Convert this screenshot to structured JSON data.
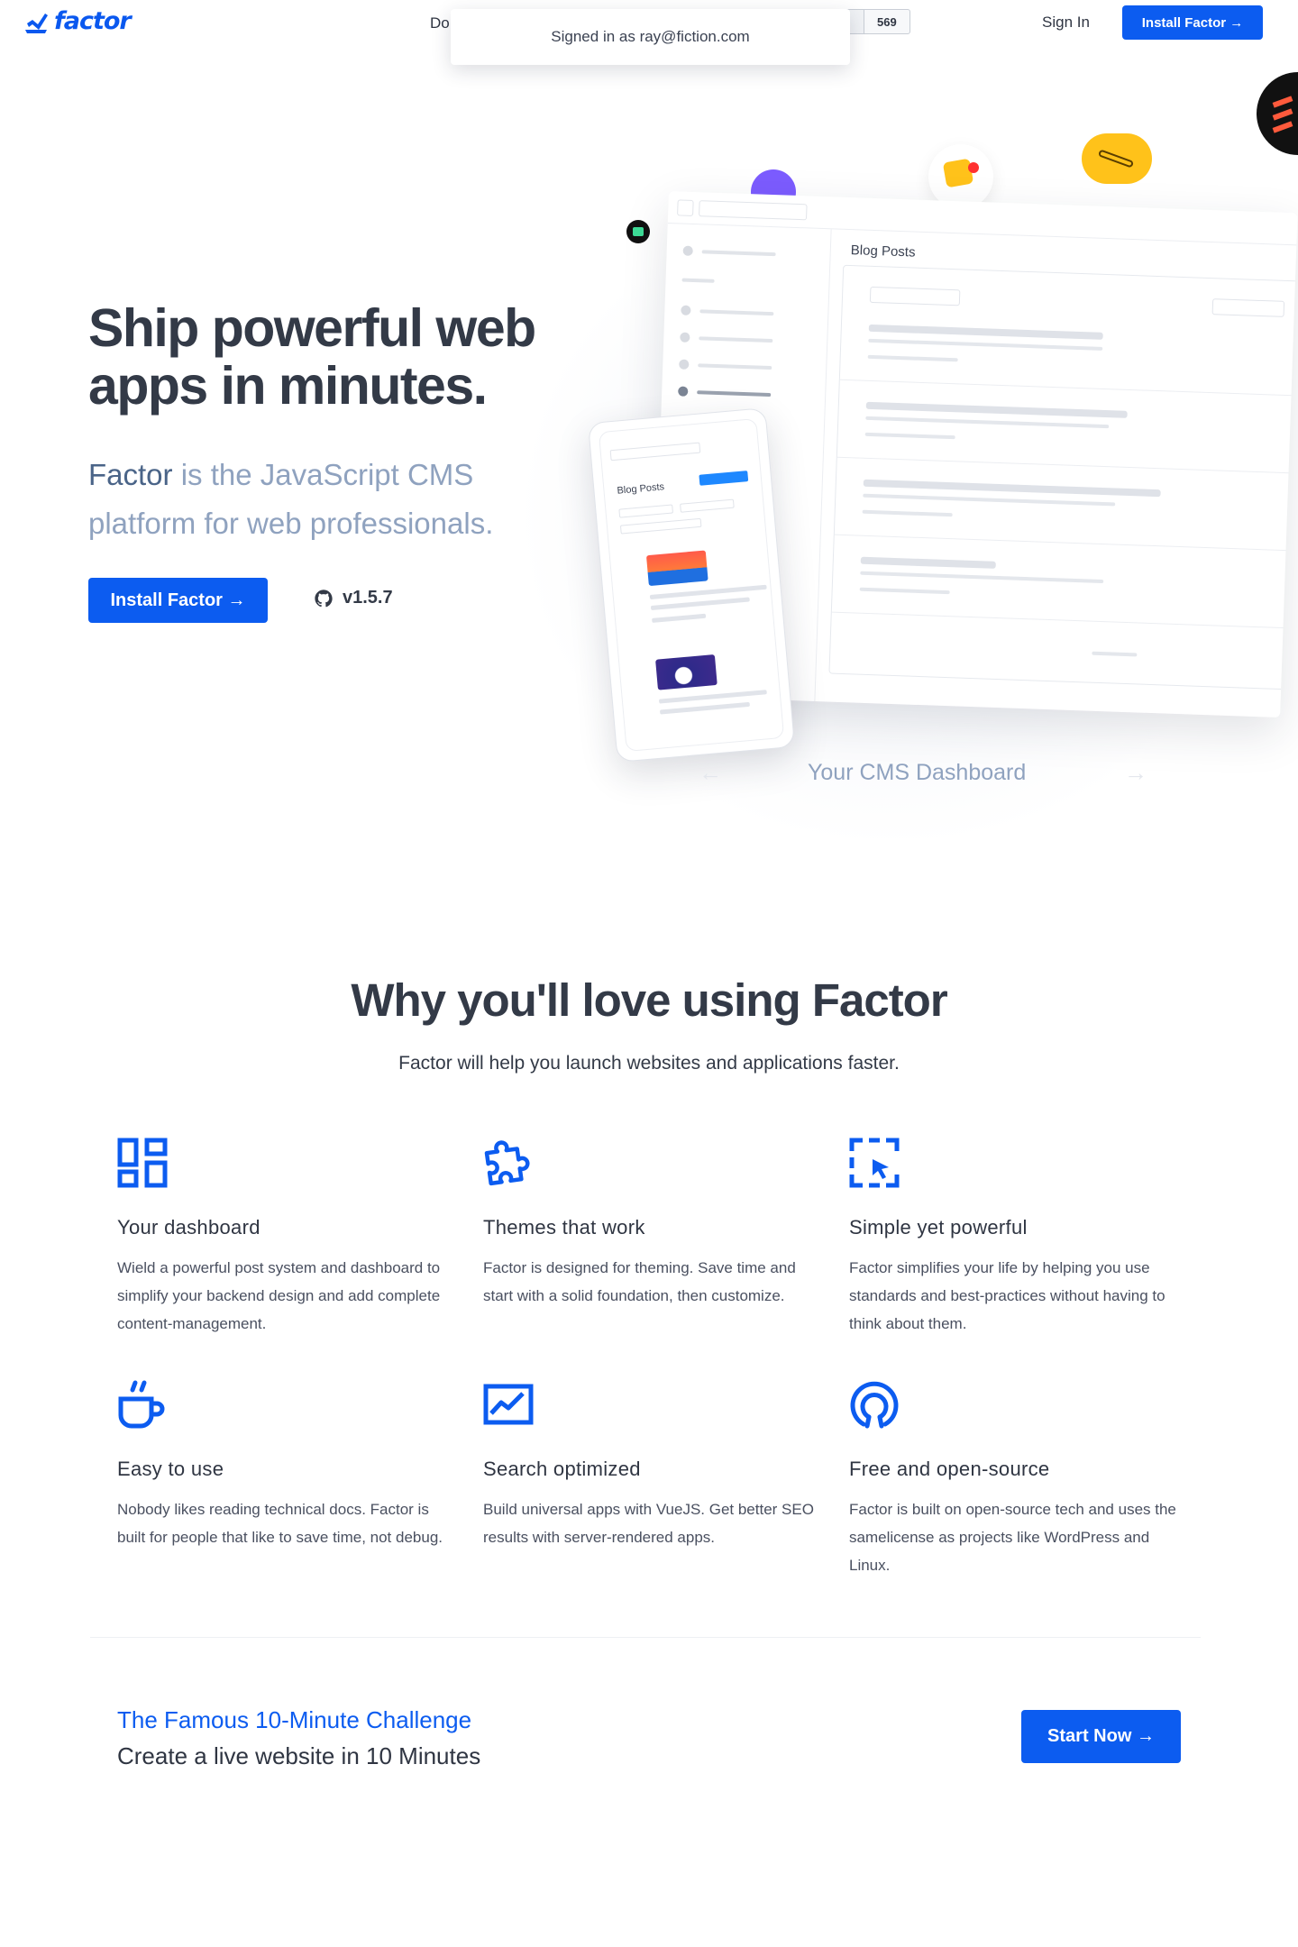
{
  "header": {
    "logo_text": "factor",
    "nav_docs": "Do",
    "star_count": "569",
    "signin": "Sign In",
    "install": "Install Factor →"
  },
  "toast": {
    "text": "Signed in as ray@fiction.com"
  },
  "hero": {
    "title": "Ship powerful web apps in minutes.",
    "subtitle_brand": "Factor",
    "subtitle_rest": " is the JavaScript CMS platform for web professionals.",
    "install_button": "Install Factor →",
    "version": "v1.5.7",
    "dashboard_heading": "Blog Posts",
    "phone_heading": "Blog Posts",
    "carousel_label": "Your CMS Dashboard"
  },
  "why": {
    "title": "Why you'll love using Factor",
    "subtitle": "Factor will help you launch websites and applications faster.",
    "features": [
      {
        "icon": "dashboard-icon",
        "title": "Your dashboard",
        "desc": "Wield a powerful post system and dashboard to simplify your backend design and add complete content-management."
      },
      {
        "icon": "puzzle-icon",
        "title": "Themes that work",
        "desc": "Factor is designed for theming. Save time and start with a solid foundation, then customize."
      },
      {
        "icon": "select-cursor-icon",
        "title": "Simple yet powerful",
        "desc": "Factor simplifies your life by helping you use standards and best-practices without having to think about them."
      },
      {
        "icon": "coffee-cup-icon",
        "title": "Easy to use",
        "desc": "Nobody likes reading technical docs. Factor is built for people that like to save time, not debug."
      },
      {
        "icon": "chart-icon",
        "title": "Search optimized",
        "desc": "Build universal apps with VueJS. Get better SEO results with server-rendered apps."
      },
      {
        "icon": "open-source-icon",
        "title": "Free and open-source",
        "desc": "Factor is built on open-source tech and uses the samelicense as projects like WordPress and Linux."
      }
    ]
  },
  "cta": {
    "title": "The Famous 10-Minute Challenge",
    "subtitle": "Create a live website in 10 Minutes",
    "button": "Start Now →"
  },
  "colors": {
    "brand": "#0c5cf0",
    "muted": "#8fa2bf",
    "text": "#2f3542"
  }
}
